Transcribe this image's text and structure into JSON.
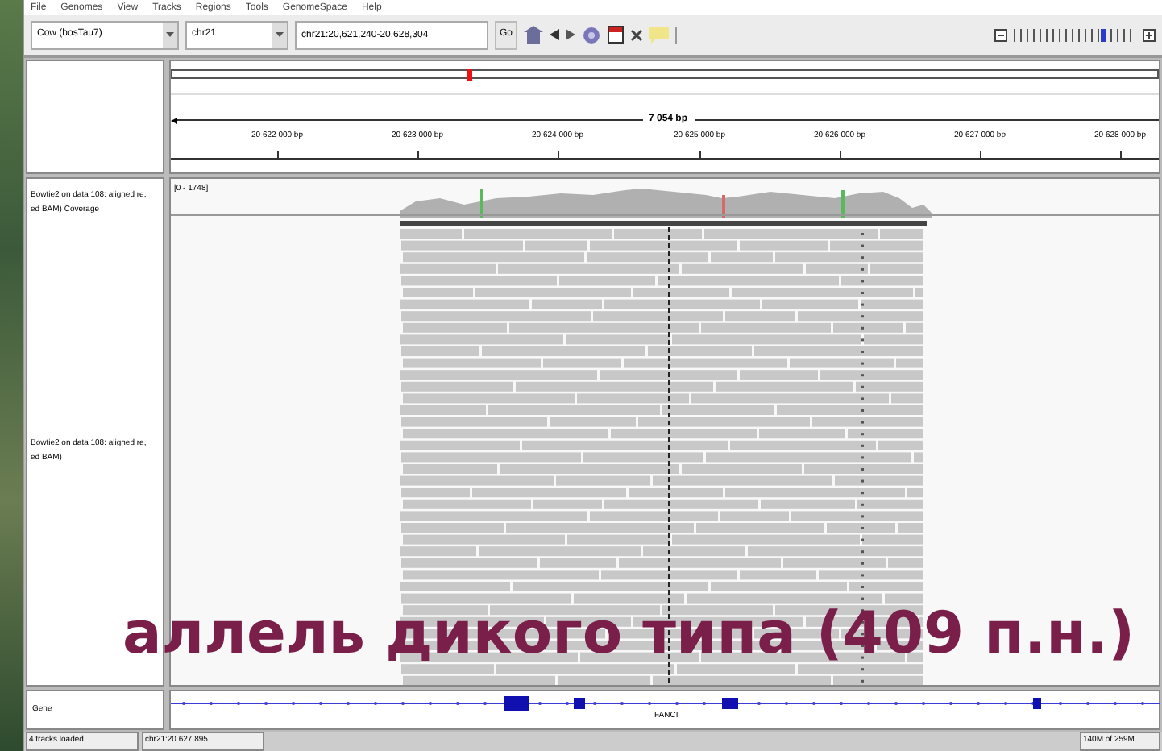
{
  "menu": [
    "File",
    "Genomes",
    "View",
    "Tracks",
    "Regions",
    "Tools",
    "GenomeSpace",
    "Help"
  ],
  "toolbar": {
    "genome": "Cow (bosTau7)",
    "chromosome": "chr21",
    "locus": "chr21:20,621,240-20,628,304",
    "go": "Go",
    "zoom": {
      "level": 0.72
    }
  },
  "ruler": {
    "span": "7 054 bp",
    "ticks": [
      "20 622 000 bp",
      "20 623 000 bp",
      "20 624 000 bp",
      "20 625 000 bp",
      "20 626 000 bp",
      "20 627 000 bp",
      "20 628 000 bp"
    ]
  },
  "tracks": [
    {
      "kind": "coverage",
      "name_lines": [
        "Bowtie2 on data 108: aligned re,",
        "ed BAM) Coverage"
      ],
      "range": "[0 - 1748]"
    },
    {
      "kind": "reads",
      "name_lines": [
        "Bowtie2 on data 108: aligned re,",
        "ed BAM)"
      ]
    }
  ],
  "caption": "аллель дикого типа (409 п.н.)",
  "gene_track": {
    "name": "Gene",
    "gene": "FANCI"
  },
  "status_bar": [
    "4 tracks loaded",
    "chr21:20 627 895",
    "140M of 259M"
  ]
}
